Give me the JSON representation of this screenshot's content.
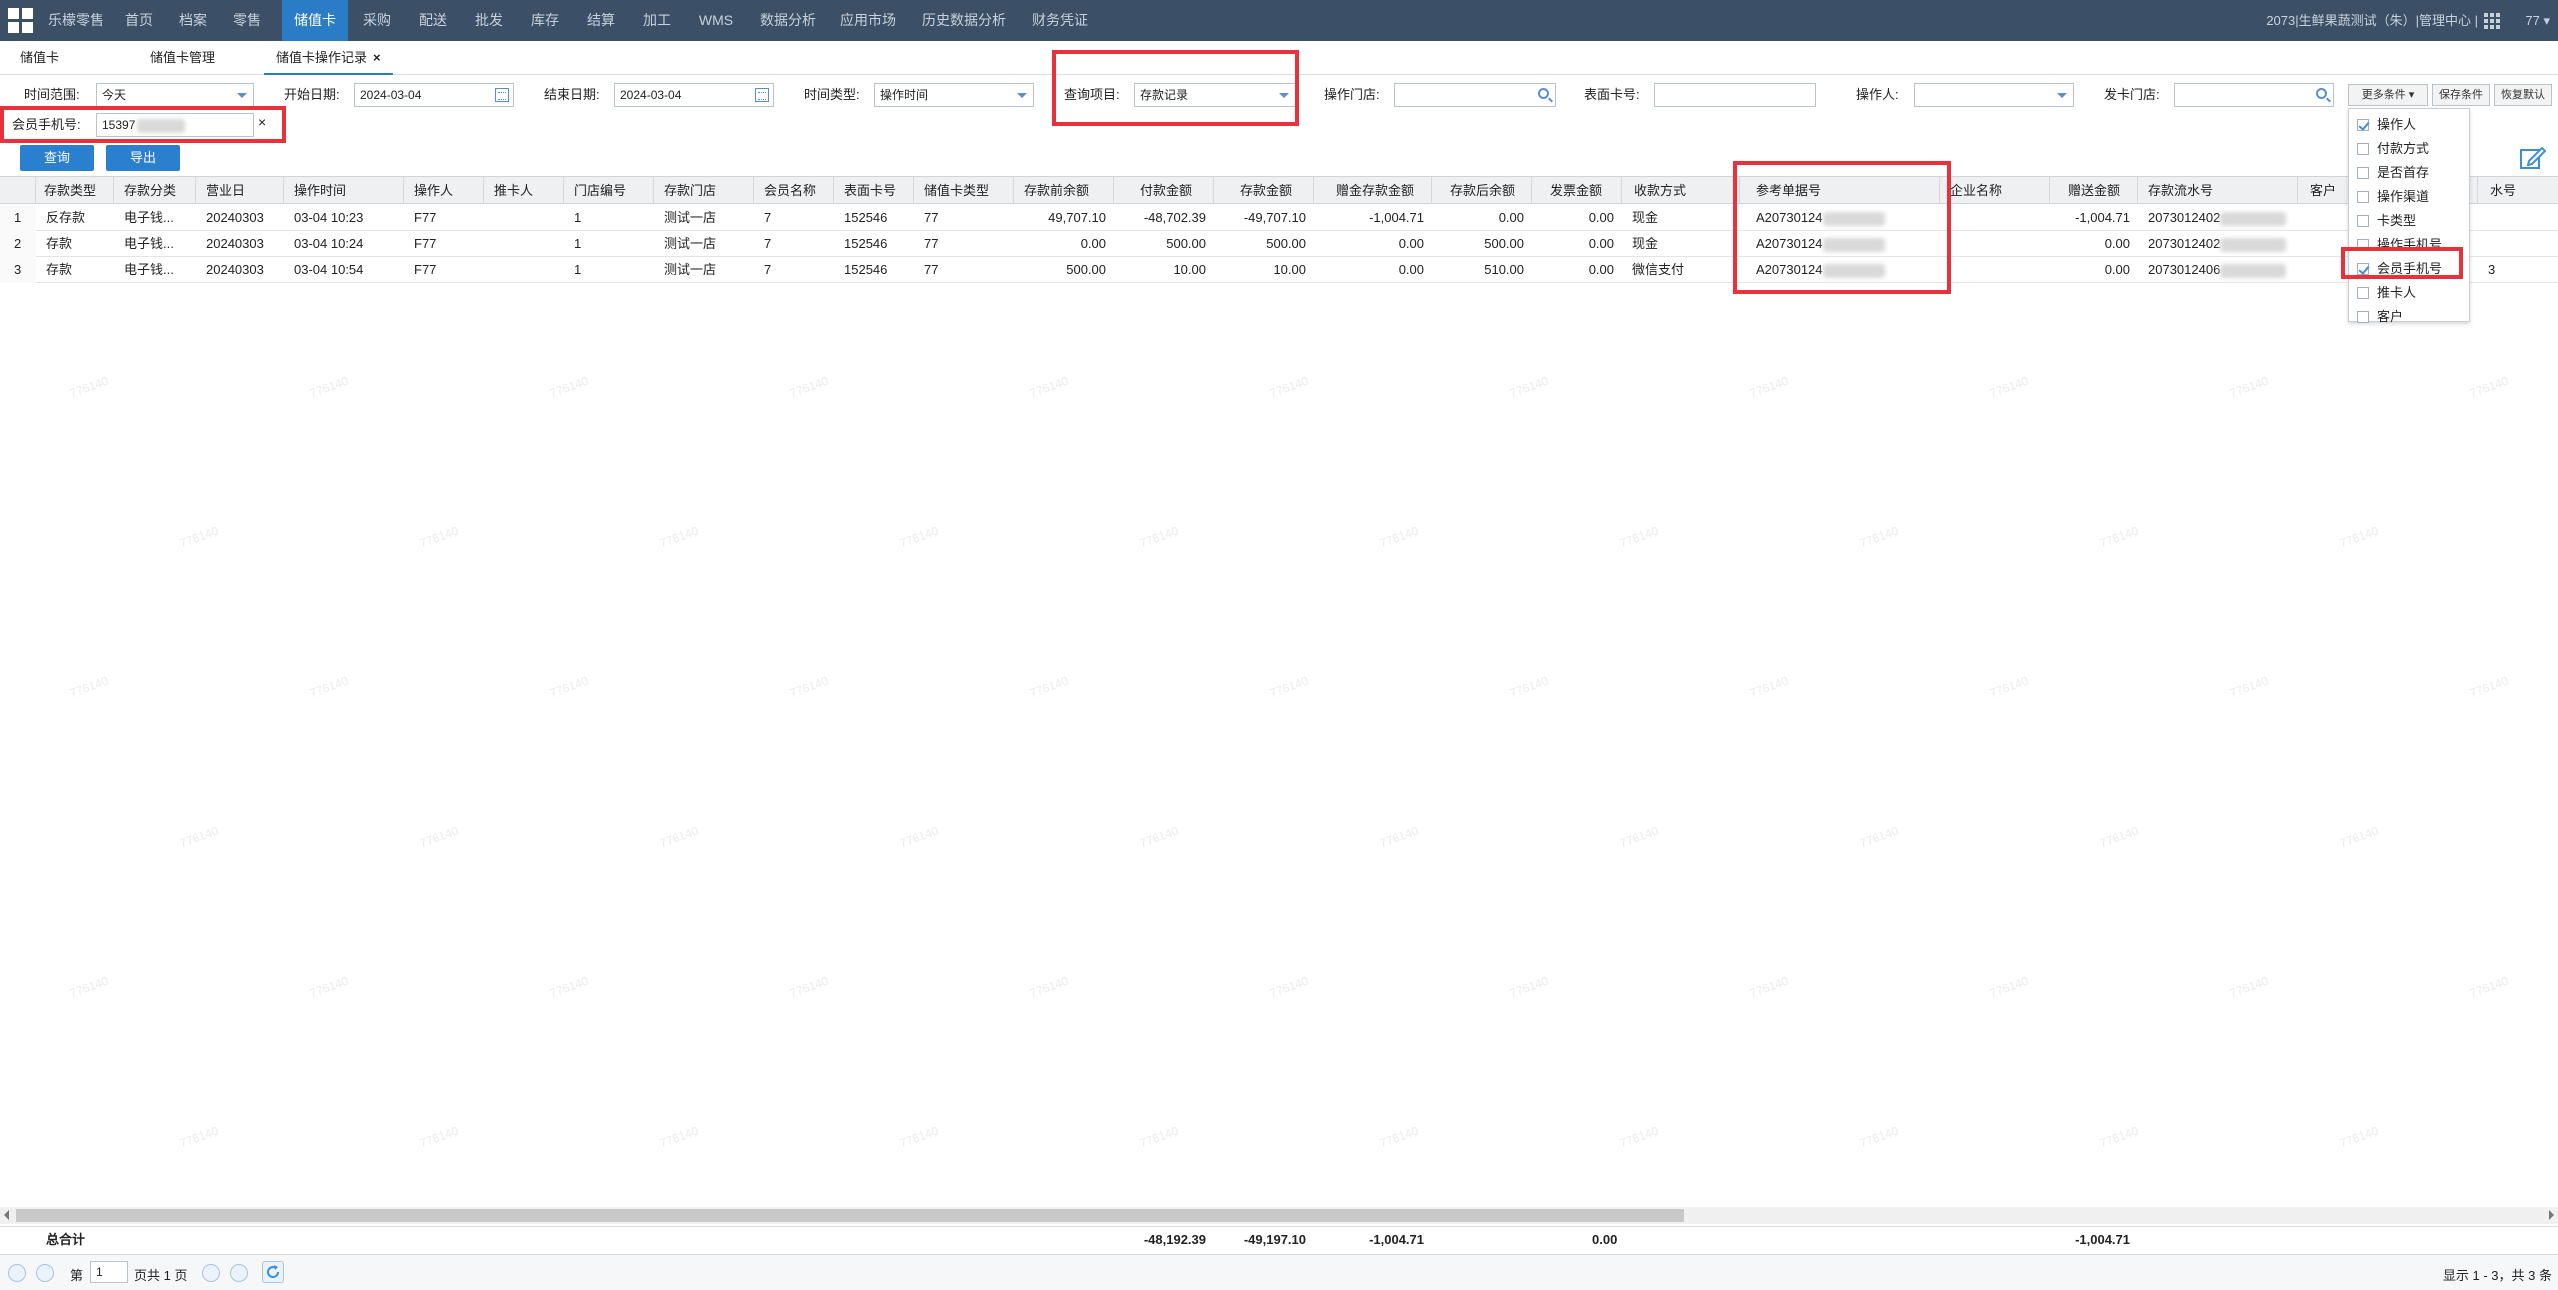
{
  "nav": {
    "items": [
      "乐檬零售",
      "首页",
      "档案",
      "零售",
      "储值卡",
      "采购",
      "配送",
      "批发",
      "库存",
      "结算",
      "加工",
      "WMS",
      "数据分析",
      "应用市场",
      "历史数据分析",
      "财务凭证"
    ],
    "account_text": "2073|生鲜果蔬测试（朱）|管理中心 |",
    "user": "77"
  },
  "tabs": {
    "items": [
      "储值卡",
      "储值卡管理",
      "储值卡操作记录"
    ],
    "close_symbol": "×"
  },
  "filters": {
    "time_range_label": "时间范围:",
    "time_range_value": "今天",
    "start_date_label": "开始日期:",
    "start_date_value": "2024-03-04",
    "end_date_label": "结束日期:",
    "end_date_value": "2024-03-04",
    "time_type_label": "时间类型:",
    "time_type_value": "操作时间",
    "query_item_label": "查询项目:",
    "query_item_value": "存款记录",
    "op_store_label": "操作门店:",
    "card_no_label": "表面卡号:",
    "operator_label": "操作人:",
    "issue_store_label": "发卡门店:",
    "more_btn": "更多条件",
    "save_btn": "保存条件",
    "restore_btn": "恢复默认",
    "phone_label": "会员手机号:",
    "phone_value": "15397",
    "clear_symbol": "×",
    "query_btn": "查询",
    "export_btn": "导出"
  },
  "more_conditions": [
    {
      "label": "操作人",
      "checked": true
    },
    {
      "label": "付款方式",
      "checked": false
    },
    {
      "label": "是否首存",
      "checked": false
    },
    {
      "label": "操作渠道",
      "checked": false
    },
    {
      "label": "卡类型",
      "checked": false
    },
    {
      "label": "操作手机号",
      "checked": false
    },
    {
      "label": "会员手机号",
      "checked": true
    },
    {
      "label": "推卡人",
      "checked": false
    },
    {
      "label": "客户",
      "checked": false
    }
  ],
  "table": {
    "headers": [
      "存款类型",
      "存款分类",
      "营业日",
      "操作时间",
      "操作人",
      "推卡人",
      "门店编号",
      "存款门店",
      "会员名称",
      "表面卡号",
      "储值卡类型",
      "存款前余额",
      "付款金额",
      "存款金额",
      "赠金存款金额",
      "存款后余额",
      "发票金额",
      "收款方式",
      "参考单据号",
      "企业名称",
      "赠送金额",
      "存款流水号",
      "客户",
      "水号"
    ],
    "rows": [
      {
        "n": "1",
        "type": "反存款",
        "cat": "电子钱...",
        "day": "20240303",
        "time": "03-04 10:23",
        "op": "F77",
        "pusher": "",
        "store_no": "1",
        "store": "测试一店",
        "member": "7",
        "card": "152546",
        "card_type": "77",
        "before": "49,707.10",
        "pay": "-48,702.39",
        "amount": "-49,707.10",
        "bonus": "-1,004.71",
        "after": "0.00",
        "invoice": "0.00",
        "method": "现金",
        "ref": "A20730124",
        "company": "",
        "gift": "-1,004.71",
        "serial": "2073012402",
        "extra": ""
      },
      {
        "n": "2",
        "type": "存款",
        "cat": "电子钱...",
        "day": "20240303",
        "time": "03-04 10:24",
        "op": "F77",
        "pusher": "",
        "store_no": "1",
        "store": "测试一店",
        "member": "7",
        "card": "152546",
        "card_type": "77",
        "before": "0.00",
        "pay": "500.00",
        "amount": "500.00",
        "bonus": "0.00",
        "after": "500.00",
        "invoice": "0.00",
        "method": "现金",
        "ref": "A20730124",
        "company": "",
        "gift": "0.00",
        "serial": "2073012402",
        "extra": ""
      },
      {
        "n": "3",
        "type": "存款",
        "cat": "电子钱...",
        "day": "20240303",
        "time": "03-04 10:54",
        "op": "F77",
        "pusher": "",
        "store_no": "1",
        "store": "测试一店",
        "member": "7",
        "card": "152546",
        "card_type": "77",
        "before": "500.00",
        "pay": "10.00",
        "amount": "10.00",
        "bonus": "0.00",
        "after": "510.00",
        "invoice": "0.00",
        "method": "微信支付",
        "ref": "A20730124",
        "company": "",
        "gift": "0.00",
        "serial": "2073012406",
        "extra": "3"
      }
    ]
  },
  "totals": {
    "label": "总合计",
    "pay": "-48,192.39",
    "amount": "-49,197.10",
    "bonus": "-1,004.71",
    "invoice": "0.00",
    "gift": "-1,004.71"
  },
  "pager": {
    "page_prefix": "第",
    "page_value": "1",
    "page_suffix": "页共 1 页",
    "summary": "显示 1 - 3，共 3 条"
  },
  "watermark": "776140",
  "colors": {
    "nav_bg": "#3b4f66",
    "accent": "#2a7cc7",
    "highlight": "#e8313b"
  }
}
